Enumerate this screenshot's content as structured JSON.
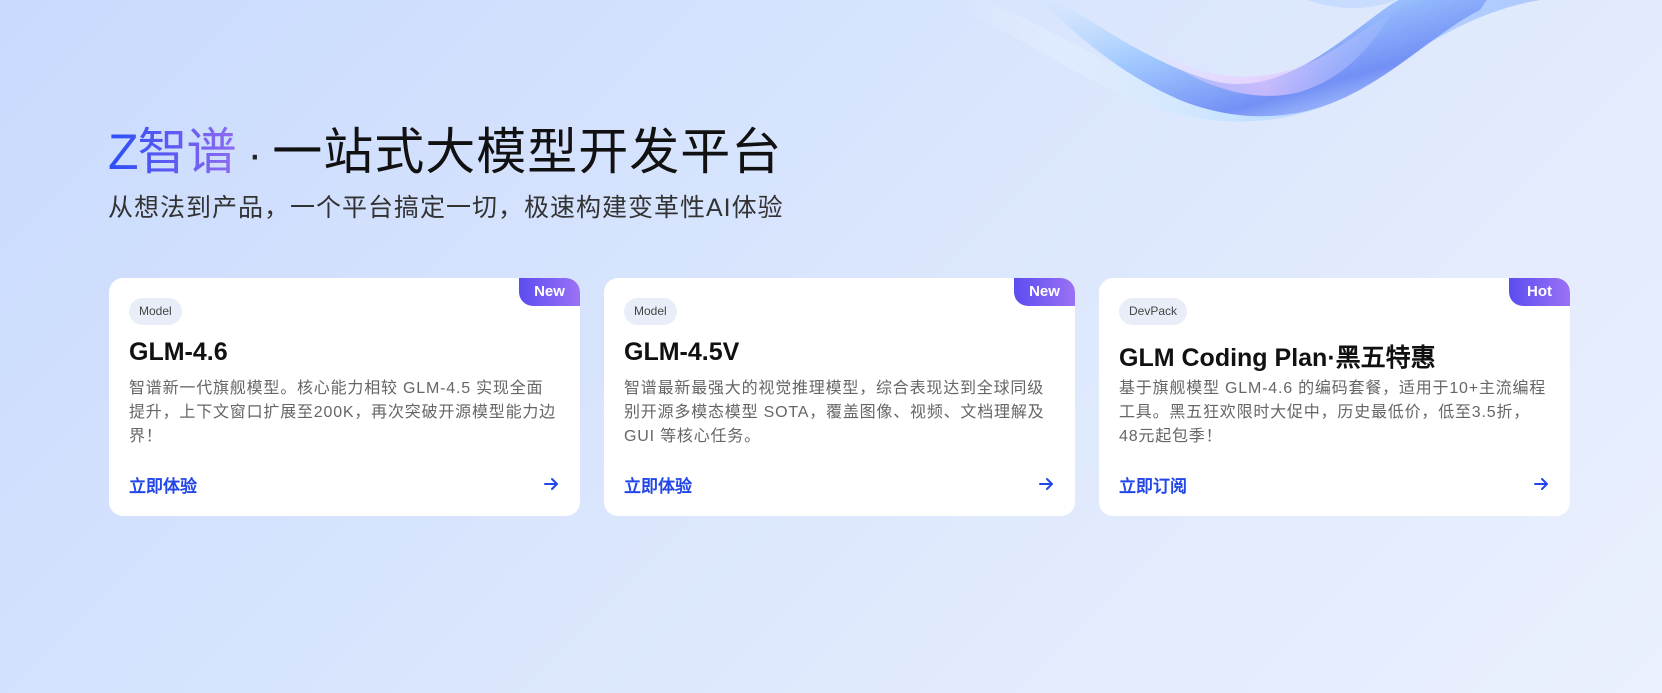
{
  "hero": {
    "brand": "Z智谱",
    "separator": "·",
    "title": "一站式大模型开发平台",
    "subtitle": "从想法到产品，一个平台搞定一切，极速构建变革性AI体验"
  },
  "cards": [
    {
      "badge": "New",
      "tag": "Model",
      "title": "GLM-4.6",
      "description": "智谱新一代旗舰模型。核心能力相较 GLM-4.5 实现全面提升，上下文窗口扩展至200K，再次突破开源模型能力边界！",
      "link_label": "立即体验"
    },
    {
      "badge": "New",
      "tag": "Model",
      "title": "GLM-4.5V",
      "description": "智谱最新最强大的视觉推理模型，综合表现达到全球同级别开源多模态模型 SOTA，覆盖图像、视频、文档理解及 GUI 等核心任务。",
      "link_label": "立即体验"
    },
    {
      "badge": "Hot",
      "tag": "DevPack",
      "title": "GLM Coding Plan·黑五特惠",
      "description": "基于旗舰模型 GLM-4.6 的编码套餐，适用于10+主流编程工具。黑五狂欢限时大促中，历史最低价，低至3.5折，48元起包季！",
      "link_label": "立即订阅"
    }
  ],
  "colors": {
    "accent": "#2346e8",
    "badge_start": "#5b4df0",
    "badge_end": "#9b72f5",
    "tag_bg": "#e9edf8"
  },
  "icons": {
    "link_arrow": "arrow-right-icon"
  }
}
